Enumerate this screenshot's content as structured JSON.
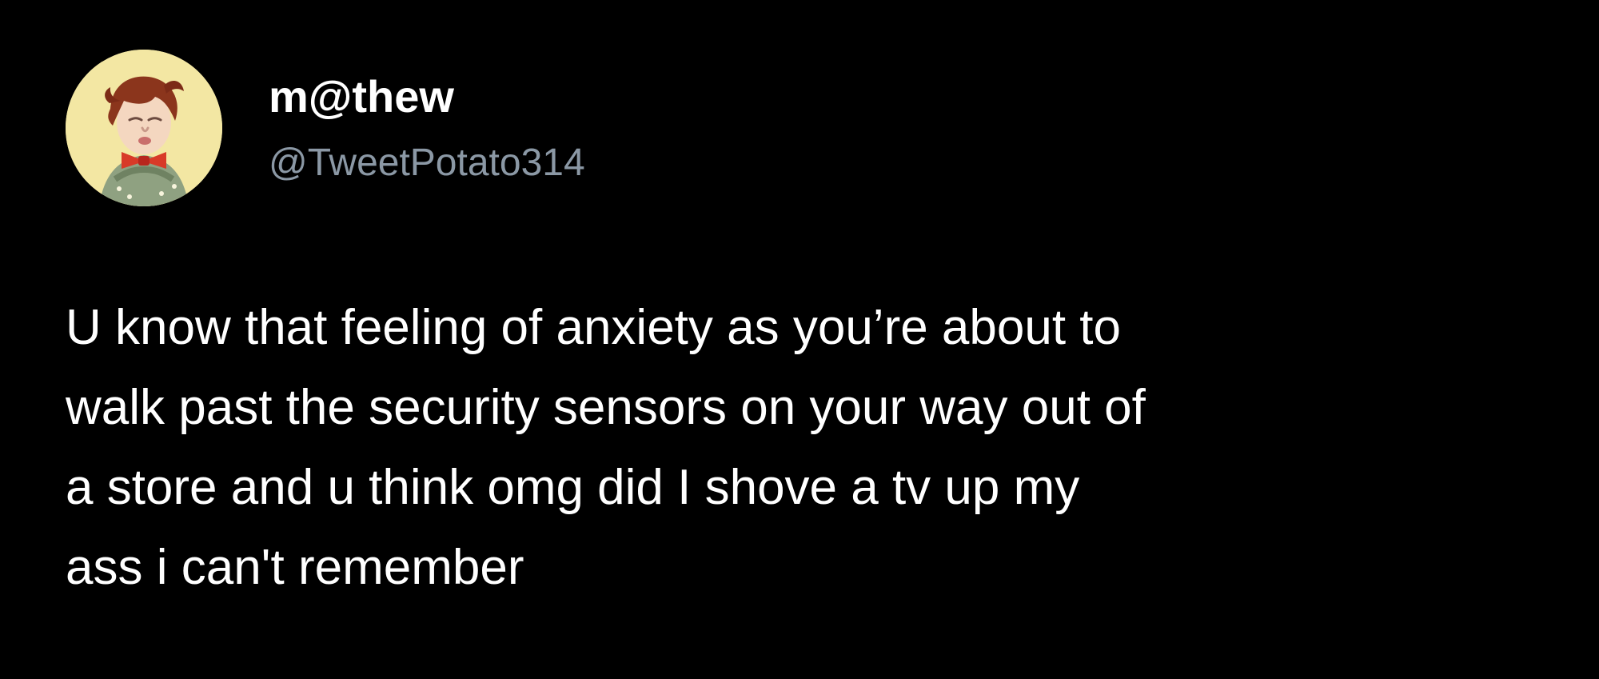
{
  "tweet": {
    "author": {
      "display_name": "m@thew",
      "handle": "@TweetPotato314",
      "avatar_icon": "child-portrait-avatar"
    },
    "text_lines": [
      "U know that feeling of anxiety as you’re about to",
      "walk past the security sensors on your way out of",
      "a store and u think omg did I shove a tv up my",
      "ass i can't remember"
    ]
  },
  "colors": {
    "background": "#000000",
    "primary_text": "#ffffff",
    "secondary_text": "#8b98a5",
    "avatar_background": "#f3e7a3"
  }
}
